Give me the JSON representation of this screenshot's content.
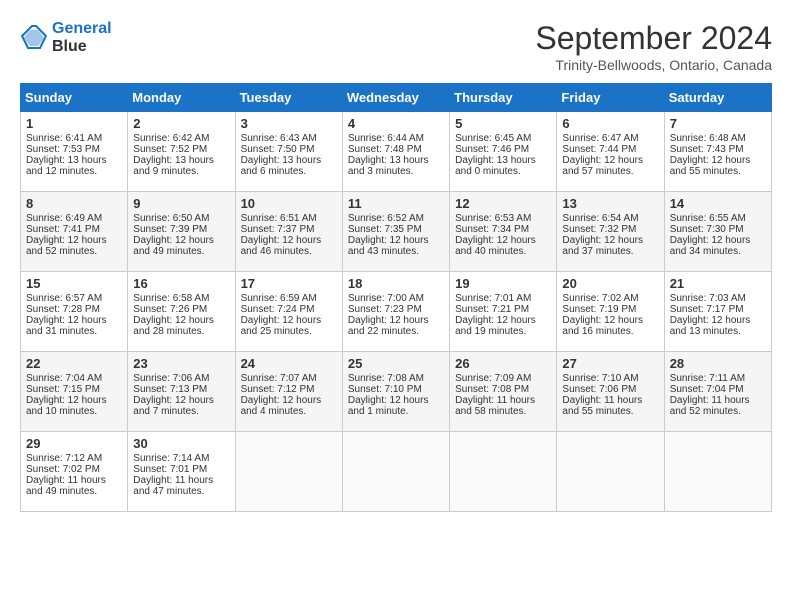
{
  "header": {
    "logo_line1": "General",
    "logo_line2": "Blue",
    "month": "September 2024",
    "location": "Trinity-Bellwoods, Ontario, Canada"
  },
  "days_of_week": [
    "Sunday",
    "Monday",
    "Tuesday",
    "Wednesday",
    "Thursday",
    "Friday",
    "Saturday"
  ],
  "weeks": [
    [
      {
        "day": "1",
        "sunrise": "6:41 AM",
        "sunset": "7:53 PM",
        "daylight": "13 hours and 12 minutes."
      },
      {
        "day": "2",
        "sunrise": "6:42 AM",
        "sunset": "7:52 PM",
        "daylight": "13 hours and 9 minutes."
      },
      {
        "day": "3",
        "sunrise": "6:43 AM",
        "sunset": "7:50 PM",
        "daylight": "13 hours and 6 minutes."
      },
      {
        "day": "4",
        "sunrise": "6:44 AM",
        "sunset": "7:48 PM",
        "daylight": "13 hours and 3 minutes."
      },
      {
        "day": "5",
        "sunrise": "6:45 AM",
        "sunset": "7:46 PM",
        "daylight": "13 hours and 0 minutes."
      },
      {
        "day": "6",
        "sunrise": "6:47 AM",
        "sunset": "7:44 PM",
        "daylight": "12 hours and 57 minutes."
      },
      {
        "day": "7",
        "sunrise": "6:48 AM",
        "sunset": "7:43 PM",
        "daylight": "12 hours and 55 minutes."
      }
    ],
    [
      {
        "day": "8",
        "sunrise": "6:49 AM",
        "sunset": "7:41 PM",
        "daylight": "12 hours and 52 minutes."
      },
      {
        "day": "9",
        "sunrise": "6:50 AM",
        "sunset": "7:39 PM",
        "daylight": "12 hours and 49 minutes."
      },
      {
        "day": "10",
        "sunrise": "6:51 AM",
        "sunset": "7:37 PM",
        "daylight": "12 hours and 46 minutes."
      },
      {
        "day": "11",
        "sunrise": "6:52 AM",
        "sunset": "7:35 PM",
        "daylight": "12 hours and 43 minutes."
      },
      {
        "day": "12",
        "sunrise": "6:53 AM",
        "sunset": "7:34 PM",
        "daylight": "12 hours and 40 minutes."
      },
      {
        "day": "13",
        "sunrise": "6:54 AM",
        "sunset": "7:32 PM",
        "daylight": "12 hours and 37 minutes."
      },
      {
        "day": "14",
        "sunrise": "6:55 AM",
        "sunset": "7:30 PM",
        "daylight": "12 hours and 34 minutes."
      }
    ],
    [
      {
        "day": "15",
        "sunrise": "6:57 AM",
        "sunset": "7:28 PM",
        "daylight": "12 hours and 31 minutes."
      },
      {
        "day": "16",
        "sunrise": "6:58 AM",
        "sunset": "7:26 PM",
        "daylight": "12 hours and 28 minutes."
      },
      {
        "day": "17",
        "sunrise": "6:59 AM",
        "sunset": "7:24 PM",
        "daylight": "12 hours and 25 minutes."
      },
      {
        "day": "18",
        "sunrise": "7:00 AM",
        "sunset": "7:23 PM",
        "daylight": "12 hours and 22 minutes."
      },
      {
        "day": "19",
        "sunrise": "7:01 AM",
        "sunset": "7:21 PM",
        "daylight": "12 hours and 19 minutes."
      },
      {
        "day": "20",
        "sunrise": "7:02 AM",
        "sunset": "7:19 PM",
        "daylight": "12 hours and 16 minutes."
      },
      {
        "day": "21",
        "sunrise": "7:03 AM",
        "sunset": "7:17 PM",
        "daylight": "12 hours and 13 minutes."
      }
    ],
    [
      {
        "day": "22",
        "sunrise": "7:04 AM",
        "sunset": "7:15 PM",
        "daylight": "12 hours and 10 minutes."
      },
      {
        "day": "23",
        "sunrise": "7:06 AM",
        "sunset": "7:13 PM",
        "daylight": "12 hours and 7 minutes."
      },
      {
        "day": "24",
        "sunrise": "7:07 AM",
        "sunset": "7:12 PM",
        "daylight": "12 hours and 4 minutes."
      },
      {
        "day": "25",
        "sunrise": "7:08 AM",
        "sunset": "7:10 PM",
        "daylight": "12 hours and 1 minute."
      },
      {
        "day": "26",
        "sunrise": "7:09 AM",
        "sunset": "7:08 PM",
        "daylight": "11 hours and 58 minutes."
      },
      {
        "day": "27",
        "sunrise": "7:10 AM",
        "sunset": "7:06 PM",
        "daylight": "11 hours and 55 minutes."
      },
      {
        "day": "28",
        "sunrise": "7:11 AM",
        "sunset": "7:04 PM",
        "daylight": "11 hours and 52 minutes."
      }
    ],
    [
      {
        "day": "29",
        "sunrise": "7:12 AM",
        "sunset": "7:02 PM",
        "daylight": "11 hours and 49 minutes."
      },
      {
        "day": "30",
        "sunrise": "7:14 AM",
        "sunset": "7:01 PM",
        "daylight": "11 hours and 47 minutes."
      },
      null,
      null,
      null,
      null,
      null
    ]
  ]
}
